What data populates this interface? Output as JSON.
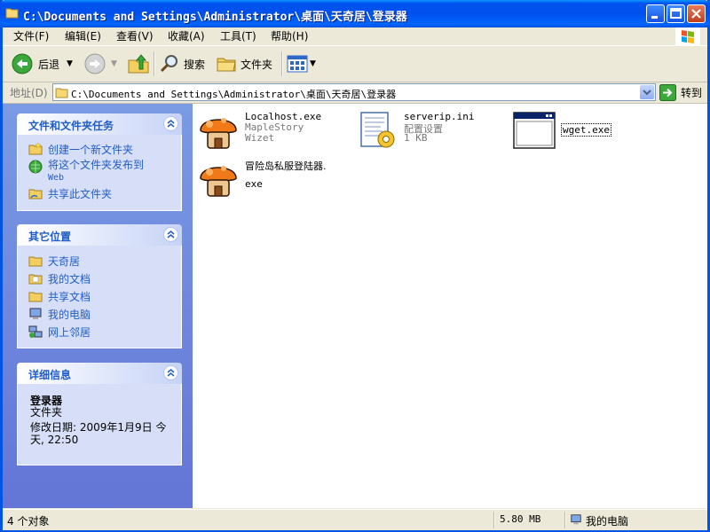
{
  "window": {
    "title": "C:\\Documents and Settings\\Administrator\\桌面\\天奇居\\登录器"
  },
  "menu": [
    "文件(F)",
    "编辑(E)",
    "查看(V)",
    "收藏(A)",
    "工具(T)",
    "帮助(H)"
  ],
  "toolbar": {
    "back_label": "后退",
    "search_label": "搜索",
    "folders_label": "文件夹"
  },
  "address": {
    "label": "地址(D)",
    "value": "C:\\Documents and Settings\\Administrator\\桌面\\天奇居\\登录器",
    "go_label": "转到"
  },
  "tasks_panel": {
    "title": "文件和文件夹任务",
    "items": [
      "创建一个新文件夹",
      "将这个文件夹发布到",
      "Web",
      "共享此文件夹"
    ]
  },
  "places_panel": {
    "title": "其它位置",
    "items": [
      "天奇居",
      "我的文档",
      "共享文档",
      "我的电脑",
      "网上邻居"
    ]
  },
  "details_panel": {
    "title": "详细信息",
    "name": "登录器",
    "type": "文件夹",
    "modified_line1": "修改日期: 2009年1月9日 今",
    "modified_line2": "天, 22:50"
  },
  "files": [
    {
      "name": "Localhost.exe",
      "line2": "MapleStory",
      "line3": "Wizet",
      "icon": "mushroom-icon"
    },
    {
      "name": "serverip.ini",
      "line2": "配置设置",
      "line3": "1 KB",
      "icon": "config-file-icon"
    },
    {
      "name": "wget.exe",
      "icon": "app-window-icon"
    },
    {
      "name": "冒险岛私服登陆器.",
      "line2": "exe",
      "icon": "mushroom-icon"
    }
  ],
  "status": {
    "count": "4 个对象",
    "size": "5.80 MB",
    "location": "我的电脑"
  },
  "colors": {
    "titlebar": "#0053ee",
    "task_link": "#215dc6",
    "left_pane": "#6375d6"
  }
}
